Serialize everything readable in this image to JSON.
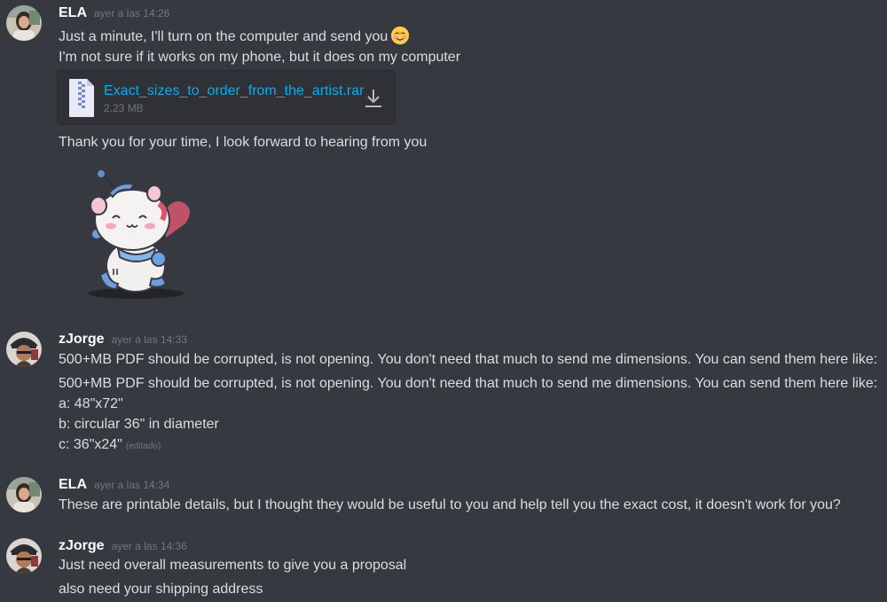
{
  "messages": [
    {
      "username": "ELA",
      "timestamp": "ayer a las 14:26",
      "lines": [
        "Just a minute, I'll turn on the computer and send you",
        "I'm not sure if it works on my phone, but it does on my computer"
      ],
      "emoji_icon": "smiling-face-icon",
      "attachment": {
        "filename": "Exact_sizes_to_order_from_the_artist.rar",
        "size": "2.23 MB"
      },
      "after_attachment": "Thank you for your time, I look forward to hearing from you",
      "sticker_icon": "hamster-sticker"
    },
    {
      "username": "zJorge",
      "timestamp": "ayer a las 14:33",
      "lines": [
        "500+MB PDF should be corrupted, is not opening.  You don't need that much to send me dimensions.  You can send them here like:",
        "500+MB PDF should be corrupted, is not opening.  You don't need that much to send me dimensions.  You can send them here like:",
        "a: 48\"x72\"",
        "b: circular 36\" in diameter",
        "c:  36\"x24\""
      ],
      "edited_label": "(editado)"
    },
    {
      "username": "ELA",
      "timestamp": "ayer a las 14:34",
      "lines": [
        "These are printable details, but I thought they would be useful to you and help tell you the exact cost, it doesn't work for you?"
      ]
    },
    {
      "username": "zJorge",
      "timestamp": "ayer a las 14:36",
      "lines": [
        "Just need overall measurements to give you a proposal",
        "also need your shipping address"
      ]
    }
  ],
  "colors": {
    "background": "#36393f",
    "text": "#dcddde",
    "username": "#ffffff",
    "timestamp": "#72767d",
    "link": "#00aff4"
  }
}
